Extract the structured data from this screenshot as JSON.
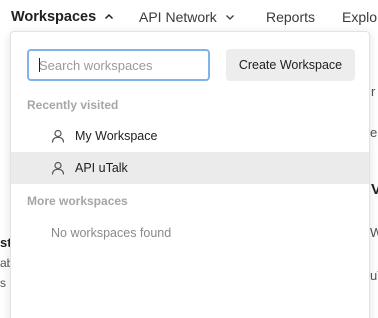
{
  "nav": {
    "workspaces": "Workspaces",
    "api_network": "API Network",
    "reports": "Reports",
    "explore": "Explo"
  },
  "background": {
    "right_1": "r",
    "right_2": "er",
    "right_3": "V",
    "right_4": "Wh",
    "right_5": "uT",
    "left_1": "st",
    "left_2": "ab",
    "left_3": "s"
  },
  "dropdown": {
    "search": {
      "placeholder": "Search workspaces",
      "value": ""
    },
    "create_label": "Create Workspace",
    "recent_label": "Recently visited",
    "recent": [
      {
        "label": "My Workspace",
        "icon": "person-icon"
      },
      {
        "label": "API uTalk",
        "icon": "person-icon"
      }
    ],
    "more_label": "More workspaces",
    "empty_label": "No workspaces found"
  }
}
